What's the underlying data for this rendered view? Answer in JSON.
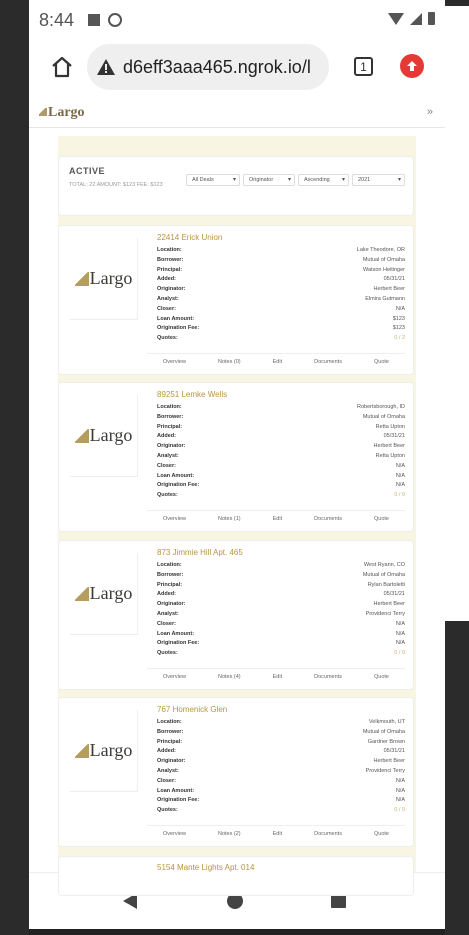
{
  "status_bar": {
    "time": "8:44"
  },
  "browser": {
    "url": "d6eff3aaa465.ngrok.io/l",
    "tab_count": "1"
  },
  "site": {
    "logo_text": "Largo",
    "menu_chevron": "»"
  },
  "filters": {
    "title": "ACTIVE",
    "meta": "TOTAL: 22 AMOUNT: $123 FEE: $123",
    "deals_select": "All Deals",
    "originator_select": "Originator",
    "order_select": "Ascending",
    "year_select": "2021"
  },
  "labels": {
    "location": "Location:",
    "borrower": "Borrower:",
    "principal": "Principal:",
    "added": "Added:",
    "originator": "Originator:",
    "analyst": "Analyst:",
    "closer": "Closer:",
    "loan_amount": "Loan Amount:",
    "origination_fee": "Origination Fee:",
    "quotes": "Quotes:"
  },
  "actions": {
    "overview": "Overview",
    "edit": "Edit",
    "documents": "Documents",
    "quote": "Quote"
  },
  "deals": [
    {
      "title": "22414 Erick Union",
      "location": "Lake Theodore, OR",
      "borrower": "Mutual of Omaha",
      "principal": "Watson Heitinger",
      "added": "05/31/21",
      "originator": "Herbert Beer",
      "analyst": "Elmira Gutmann",
      "closer": "N/A",
      "loan_amount": "$123",
      "origination_fee": "$123",
      "quotes": "0 / 2",
      "notes": "Notes (0)"
    },
    {
      "title": "89251 Lemke Wells",
      "location": "Robertsborough, ID",
      "borrower": "Mutual of Omaha",
      "principal": "Retta Upton",
      "added": "05/31/21",
      "originator": "Herbert Beer",
      "analyst": "Retta Upton",
      "closer": "N/A",
      "loan_amount": "N/A",
      "origination_fee": "N/A",
      "quotes": "0 / 0",
      "notes": "Notes (1)"
    },
    {
      "title": "873 Jimmie Hill Apt. 465",
      "location": "West Ryann, CO",
      "borrower": "Mutual of Omaha",
      "principal": "Rylan Bartoletti",
      "added": "05/31/21",
      "originator": "Herbert Beer",
      "analyst": "Providenci Terry",
      "closer": "N/A",
      "loan_amount": "N/A",
      "origination_fee": "N/A",
      "quotes": "0 / 0",
      "notes": "Notes (4)"
    },
    {
      "title": "767 Homenick Glen",
      "location": "Velkmouth, UT",
      "borrower": "Mutual of Omaha",
      "principal": "Gardner Brown",
      "added": "05/31/21",
      "originator": "Herbert Beer",
      "analyst": "Providenci Terry",
      "closer": "N/A",
      "loan_amount": "N/A",
      "origination_fee": "N/A",
      "quotes": "0 / 0",
      "notes": "Notes (2)"
    }
  ],
  "partial_deal": {
    "title": "5154 Mante Lights Apt. 014"
  }
}
